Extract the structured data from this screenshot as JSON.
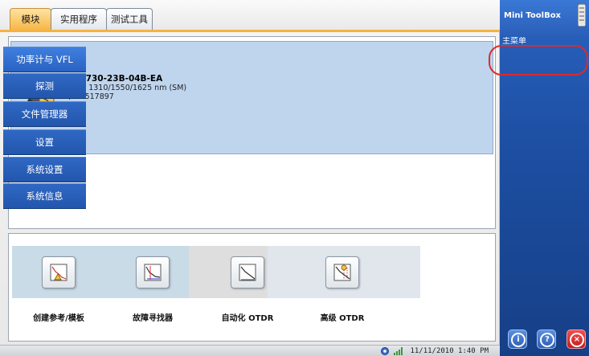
{
  "tabs": [
    {
      "label": "模块",
      "active": true
    },
    {
      "label": "实用程序",
      "active": false
    },
    {
      "label": "测试工具",
      "active": false
    }
  ],
  "module": {
    "name": "FTB-730-23B-04B-EA",
    "description": "OTDR 1310/1550/1625 nm (SM)",
    "serial": "S/N : 517897"
  },
  "apps": [
    {
      "label": "创建参考/模板",
      "icon": "reference-template-icon"
    },
    {
      "label": "故障寻找器",
      "icon": "fault-finder-icon"
    },
    {
      "label": "自动化 OTDR",
      "icon": "auto-otdr-icon"
    },
    {
      "label": "高级 OTDR",
      "icon": "advanced-otdr-icon"
    }
  ],
  "sidebar": {
    "title": "Mini ToolBox",
    "section": "主菜单",
    "items": [
      {
        "label": "功率计与 VFL"
      },
      {
        "label": "探测"
      },
      {
        "label": "文件管理器"
      },
      {
        "label": "设置"
      },
      {
        "label": "系统设置"
      },
      {
        "label": "系统信息"
      }
    ]
  },
  "statusbar": {
    "datetime": "11/11/2010 1:40 PM"
  },
  "colors": {
    "active_tab": "#f6b33f",
    "sidebar": "#1d4fa3",
    "selected_module": "#bfd5ee",
    "highlight": "#e0292b",
    "close_button": "#d02a2a"
  }
}
